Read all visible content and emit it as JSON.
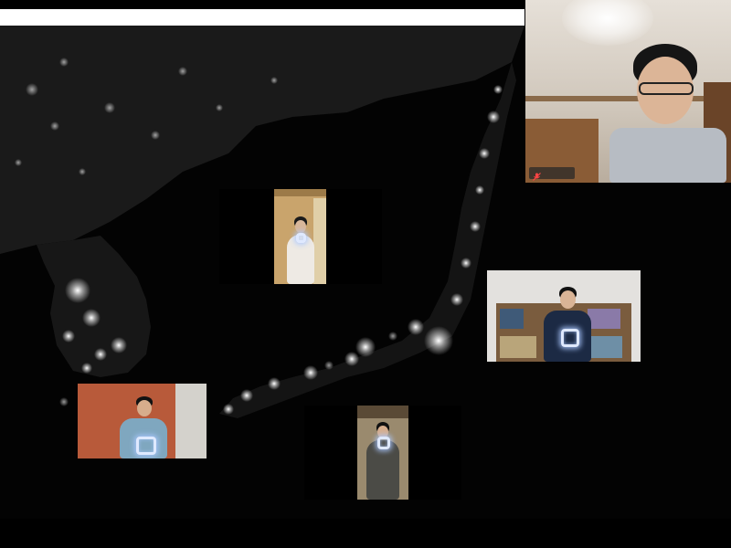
{
  "meeting": {
    "layout": "custom-background-gallery",
    "background_image": "night-satellite-map-japan-korea",
    "colors": {
      "background": "#000000",
      "city_lights": "#ffffff",
      "land_dim": "#1c1c1c",
      "sign_glow": "#cfe0ff"
    }
  },
  "self_view": {
    "name": "",
    "mic_state": "muted",
    "mic_icon": "mic-muted-icon"
  },
  "participants": [
    {
      "id": "center-top",
      "holding": "glowing-square-sign"
    },
    {
      "id": "right",
      "holding": "glowing-square-sign"
    },
    {
      "id": "left-bottom",
      "holding": "glowing-square-sign"
    },
    {
      "id": "bottom-center",
      "holding": "glowing-square-sign"
    }
  ]
}
